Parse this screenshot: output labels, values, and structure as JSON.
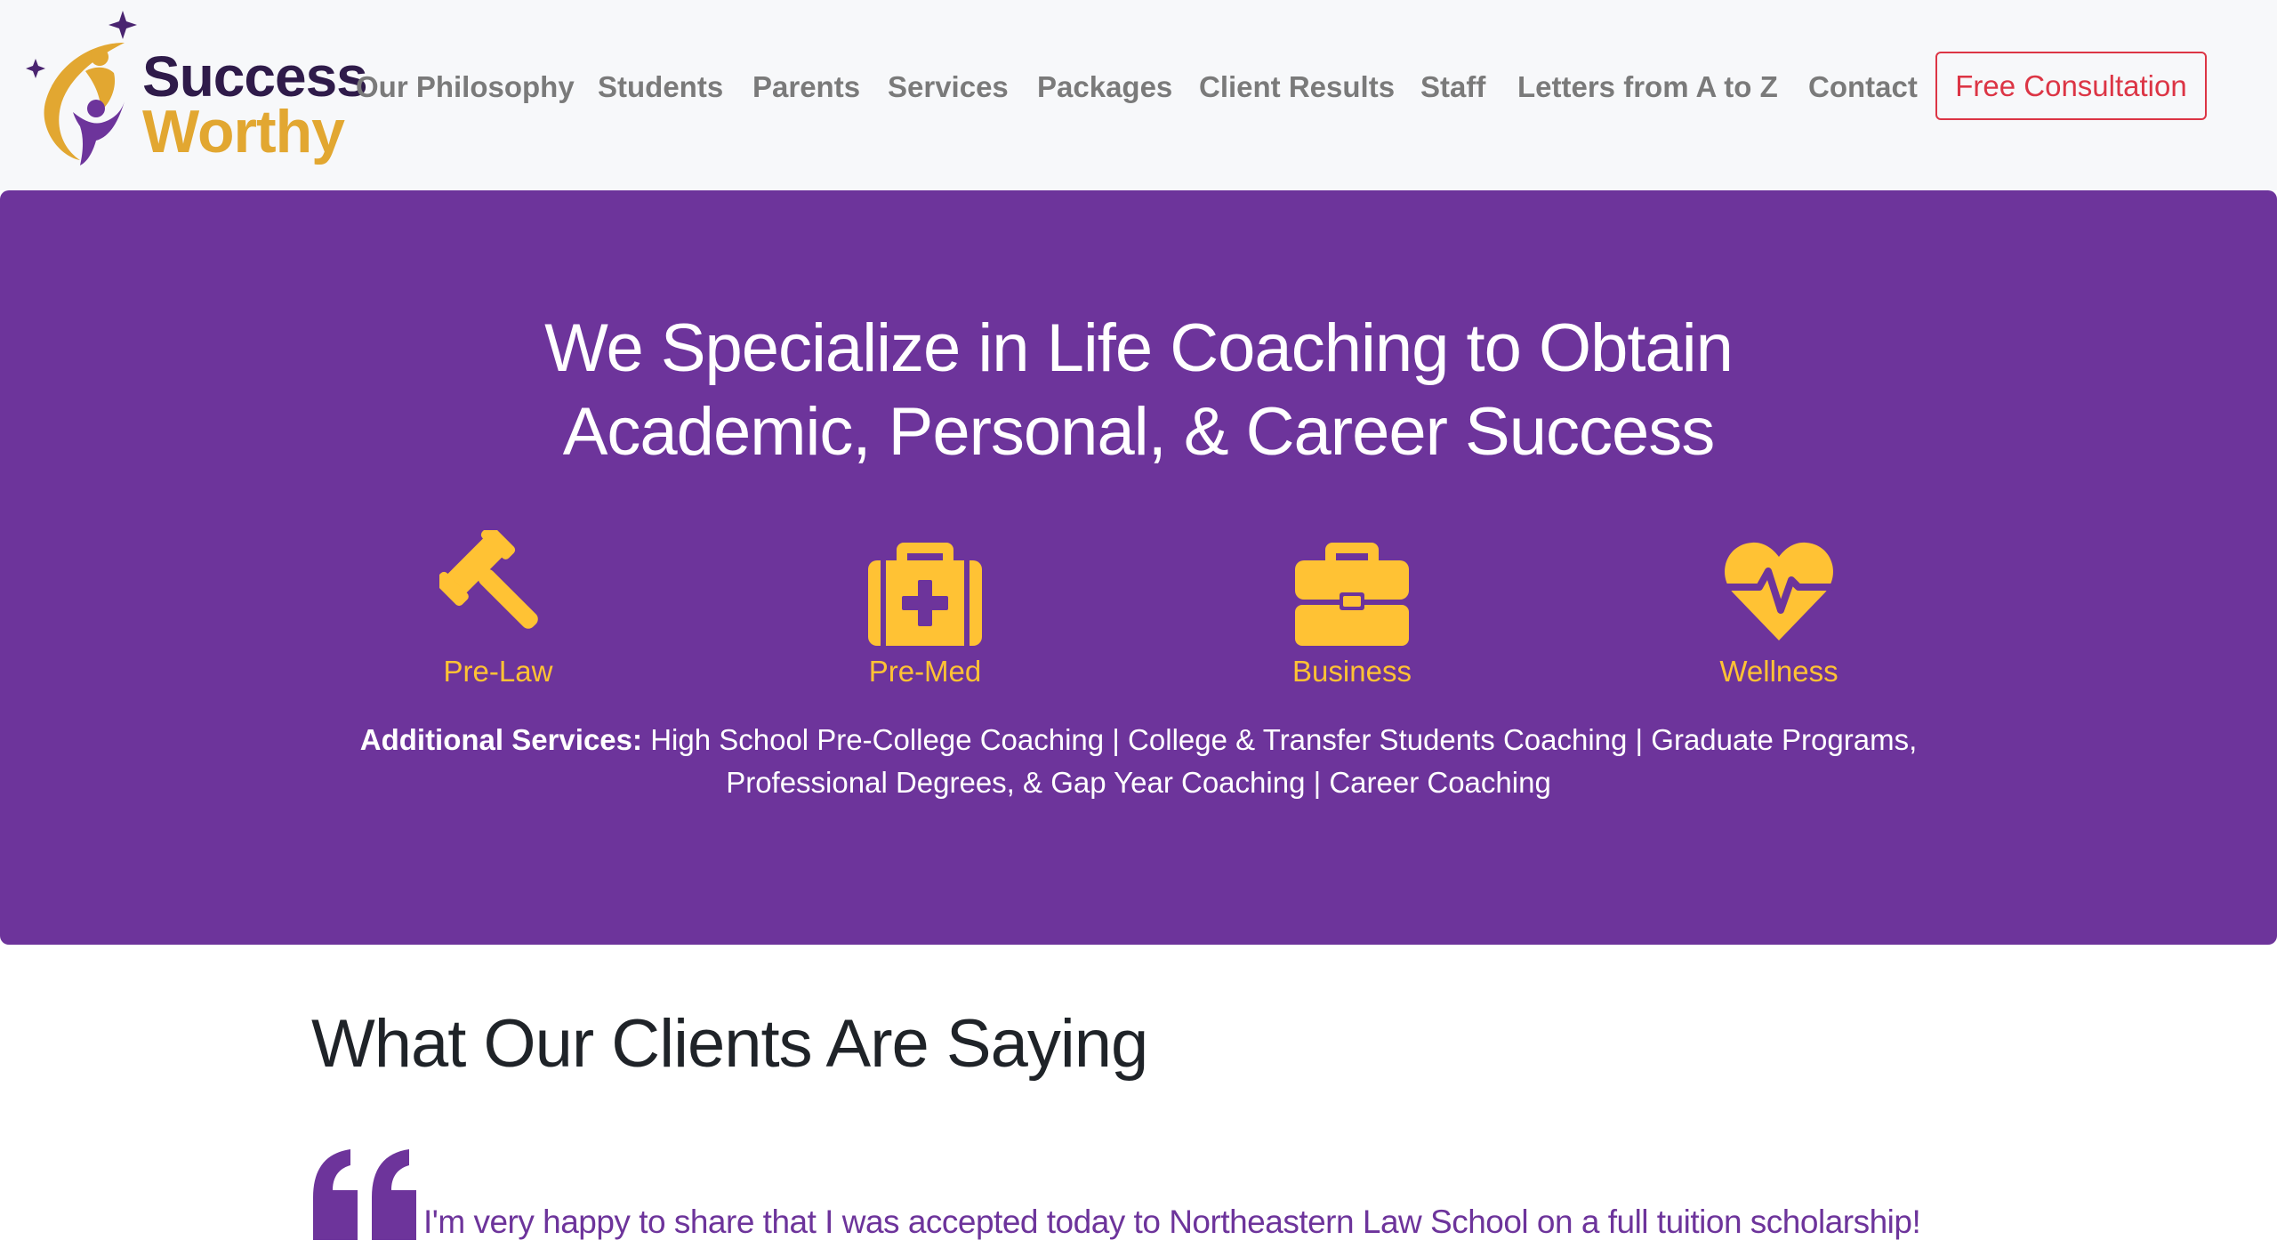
{
  "brand": {
    "name_line1": "Success",
    "name_line2": "Worthy",
    "colors": {
      "purple": "#5a2a82",
      "gold": "#e2a731"
    }
  },
  "nav": {
    "items": [
      {
        "label": "Our Philosophy"
      },
      {
        "label": "Students"
      },
      {
        "label": "Parents"
      },
      {
        "label": "Services"
      },
      {
        "label": "Packages"
      },
      {
        "label": "Client Results"
      },
      {
        "label": "Staff"
      },
      {
        "label": "Letters from A to Z"
      },
      {
        "label": "Contact"
      }
    ],
    "cta_label": "Free Consultation"
  },
  "hero": {
    "title_line1": "We Specialize in Life Coaching to Obtain",
    "title_line2": "Academic, Personal, & Career Success",
    "services": [
      {
        "label": "Pre-Law",
        "icon": "gavel-icon"
      },
      {
        "label": "Pre-Med",
        "icon": "medkit-icon"
      },
      {
        "label": "Business",
        "icon": "briefcase-icon"
      },
      {
        "label": "Wellness",
        "icon": "heartbeat-icon"
      }
    ],
    "additional_label": "Additional Services:",
    "additional_line1": "High School Pre-College Coaching | College & Transfer Students Coaching | Graduate Programs,",
    "additional_line2": "Professional Degrees, & Gap Year Coaching | Career Coaching",
    "colors": {
      "background": "#6d349b",
      "accent": "#ffc234"
    }
  },
  "testimonials": {
    "heading": "What Our Clients Are Saying",
    "quote": "I'm very happy to share that I was accepted today to Northeastern Law School on a full tuition scholarship!"
  }
}
